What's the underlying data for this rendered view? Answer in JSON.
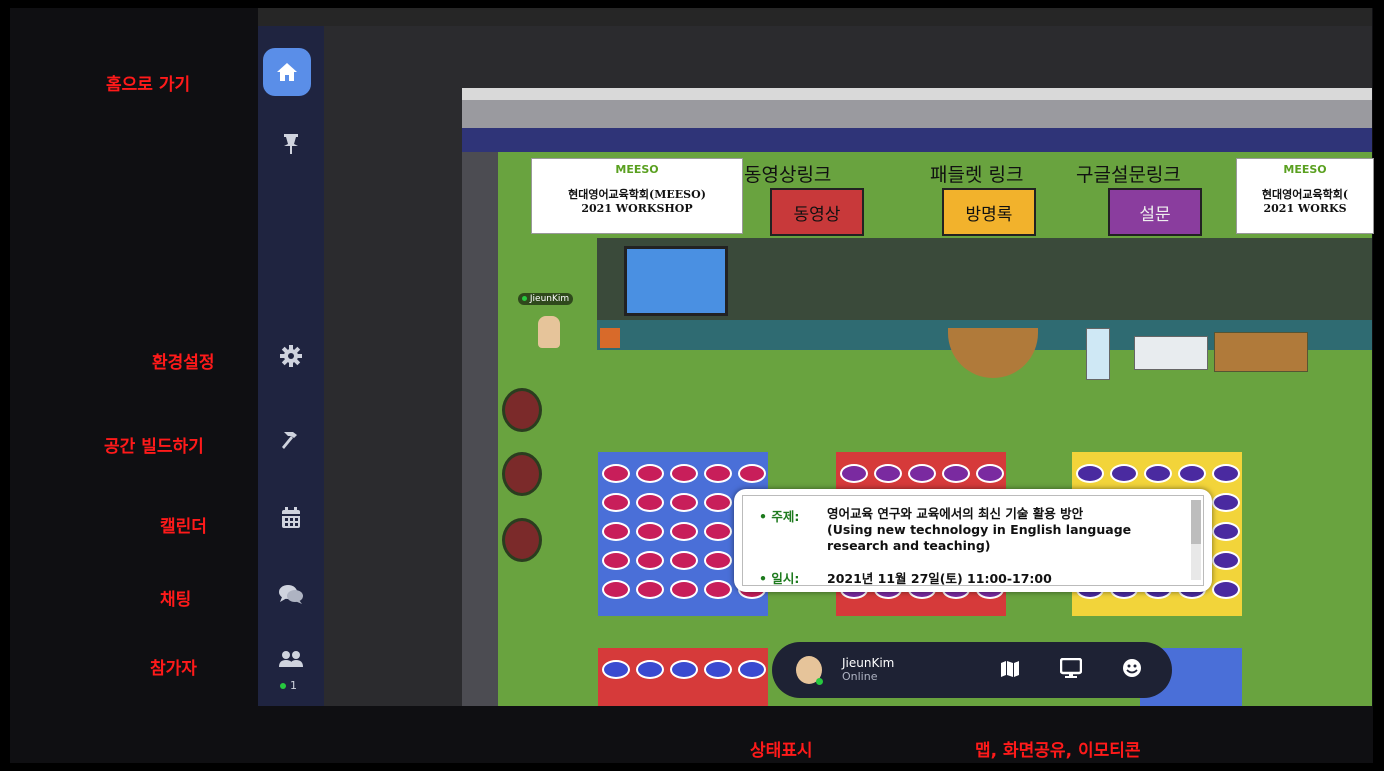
{
  "annotations": {
    "home": "홈으로 가기",
    "settings": "환경설정",
    "build": "공간 빌드하기",
    "calendar": "캘린더",
    "chat": "채팅",
    "participants": "참가자",
    "status": "상태표시",
    "tools": "맵, 화면공유, 이모티콘"
  },
  "sidebar": {
    "participant_count": "1"
  },
  "map": {
    "poster_left": {
      "logo": "MEESO",
      "line1": "현대영어교육학회(MEESO)",
      "line2": "2021 WORKSHOP"
    },
    "poster_right": {
      "logo": "MEESO",
      "line1": "현대영어교육학회(",
      "line2": "2021 WORKS"
    },
    "signs": [
      "동영상링크",
      "패들렛 링크",
      "구글설문링크"
    ],
    "banners": [
      {
        "label": "동영상",
        "color": "#c8393a"
      },
      {
        "label": "방명록",
        "color": "#f2b22c"
      },
      {
        "label": "설문",
        "color": "#8a3d9e"
      }
    ],
    "player_name": "JieunKim"
  },
  "popup": {
    "topic_key": "• 주제:",
    "topic_value_1": "영어교육 연구와 교육에서의 최신 기술 활용 방안",
    "topic_value_2": "(Using new technology in English language",
    "topic_value_3": "research and teaching)",
    "date_key": "• 일시:",
    "date_value": "2021년 11월 27일(토) 11:00-17:00"
  },
  "statusbar": {
    "name": "JieunKim",
    "status": "Online",
    "icons": [
      "map-icon",
      "screen-share-icon",
      "emoji-icon"
    ]
  },
  "colors": {
    "accent_blue": "#5a8ee8",
    "annotation_red": "#ff1a1a",
    "online_green": "#27c93f"
  }
}
